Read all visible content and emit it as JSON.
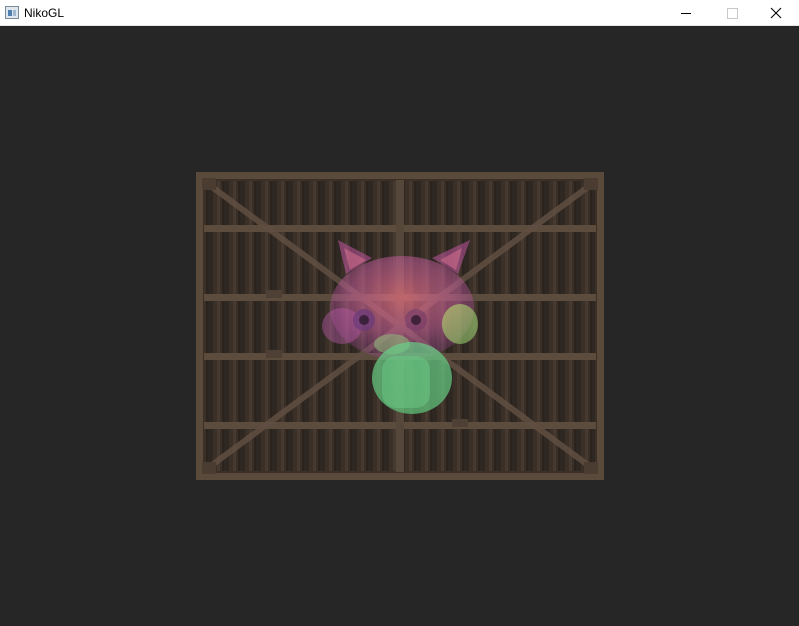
{
  "window": {
    "title": "NikoGL",
    "background": "#262626",
    "icons": {
      "app": "app-window-icon",
      "minimize": "minimize-icon",
      "maximize": "maximize-icon",
      "close": "close-icon"
    }
  },
  "scene": {
    "texture": "wooden-crate",
    "overlay": "cat-face-tinted",
    "overlay_colors": [
      "#d96fa8",
      "#e07a7a",
      "#6fc98a",
      "#a6c06a"
    ]
  }
}
